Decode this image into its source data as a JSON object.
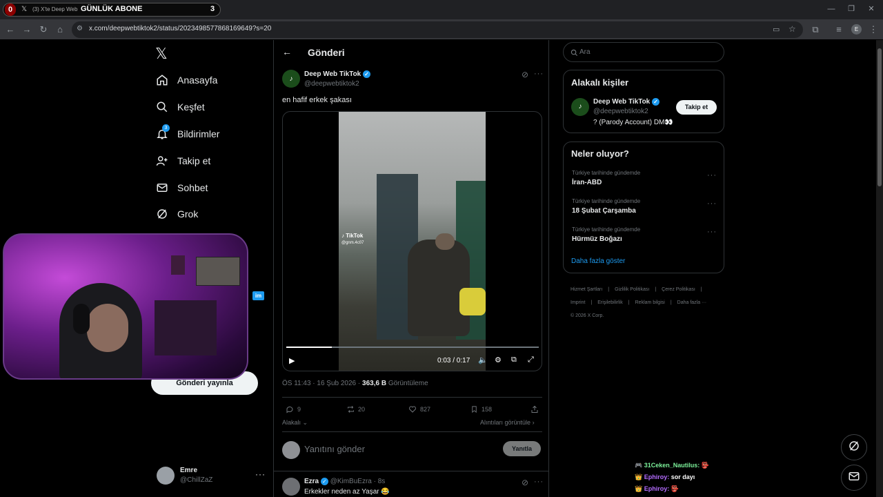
{
  "browser": {
    "overlay_label": "GÜNLÜK ABONE",
    "overlay_count_left": "0",
    "overlay_count_right": "3",
    "tab_title": "(3) X'te Deep Web",
    "url": "x.com/deepwebtiktok2/status/2023498577868169649?s=20",
    "profile_initial": "E"
  },
  "nav": {
    "items": [
      {
        "label": "Anasayfa",
        "icon": "home-icon"
      },
      {
        "label": "Keşfet",
        "icon": "search-icon"
      },
      {
        "label": "Bildirimler",
        "icon": "bell-icon",
        "badge": "3"
      },
      {
        "label": "Takip et",
        "icon": "follow-icon"
      },
      {
        "label": "Sohbet",
        "icon": "mail-icon"
      },
      {
        "label": "Grok",
        "icon": "grok-icon"
      }
    ],
    "post_button": "Gönderi yayınla",
    "partial_label": "im",
    "user_name": "Emre",
    "user_handle": "@ChillZaZ"
  },
  "main": {
    "header_title": "Gönderi",
    "author_name": "Deep Web TikTok",
    "author_handle": "@deepwebtiktok2",
    "text": "en hafif erkek şakası",
    "video_time": "0:03 / 0:17",
    "video_progress": 0.18,
    "watermark_name": "TikTok",
    "watermark_handle": "@gnm.4c07",
    "meta_time": "ÖS 11:43 · 16 Şub 2026 · ",
    "meta_views": "363,6 B",
    "meta_views_label": " Görüntüleme",
    "replies": "9",
    "reposts": "20",
    "likes": "827",
    "bookmarks": "158",
    "relevant": "Alakalı",
    "quotes": "Alıntıları görüntüle",
    "reply_placeholder": "Yanıtını gönder",
    "reply_button": "Yanıtla",
    "reply_author": "Ezra",
    "reply_handle": "@KimBuEzra · 8s",
    "reply_text": "Erkekler neden az Yaşar 😂"
  },
  "right": {
    "search_placeholder": "Ara",
    "people_title": "Alakalı kişiler",
    "person_name": "Deep Web TikTok",
    "person_handle": "@deepwebtiktok2",
    "person_bio": "? (Parody Account) DM👀",
    "follow_button": "Takip et",
    "trends_title": "Neler oluyor?",
    "trends": [
      {
        "category": "Türkiye tarihinde gündemde",
        "title": "İran-ABD"
      },
      {
        "category": "Türkiye tarihinde gündemde",
        "title": "18 Şubat Çarşamba"
      },
      {
        "category": "Türkiye tarihinde gündemde",
        "title": "Hürmüz Boğazı"
      }
    ],
    "show_more": "Daha fazla göster",
    "footer": [
      "Hizmet Şartları",
      "|",
      "Gizlilik Politikası",
      "|",
      "Çerez Politikası",
      "|",
      "Imprint",
      "|",
      "Erişilebilirlik",
      "|",
      "Reklam bilgisi",
      "|",
      "Daha fazla ···",
      "© 2026 X Corp."
    ]
  },
  "chat": [
    {
      "user": "31Ceken_Nautilus:",
      "msg": "",
      "color": "#7cf29a"
    },
    {
      "user": "Ephiroy:",
      "msg": "sor dayı",
      "color": "#b46cff"
    },
    {
      "user": "Ephiroy:",
      "msg": "",
      "color": "#b46cff"
    }
  ]
}
